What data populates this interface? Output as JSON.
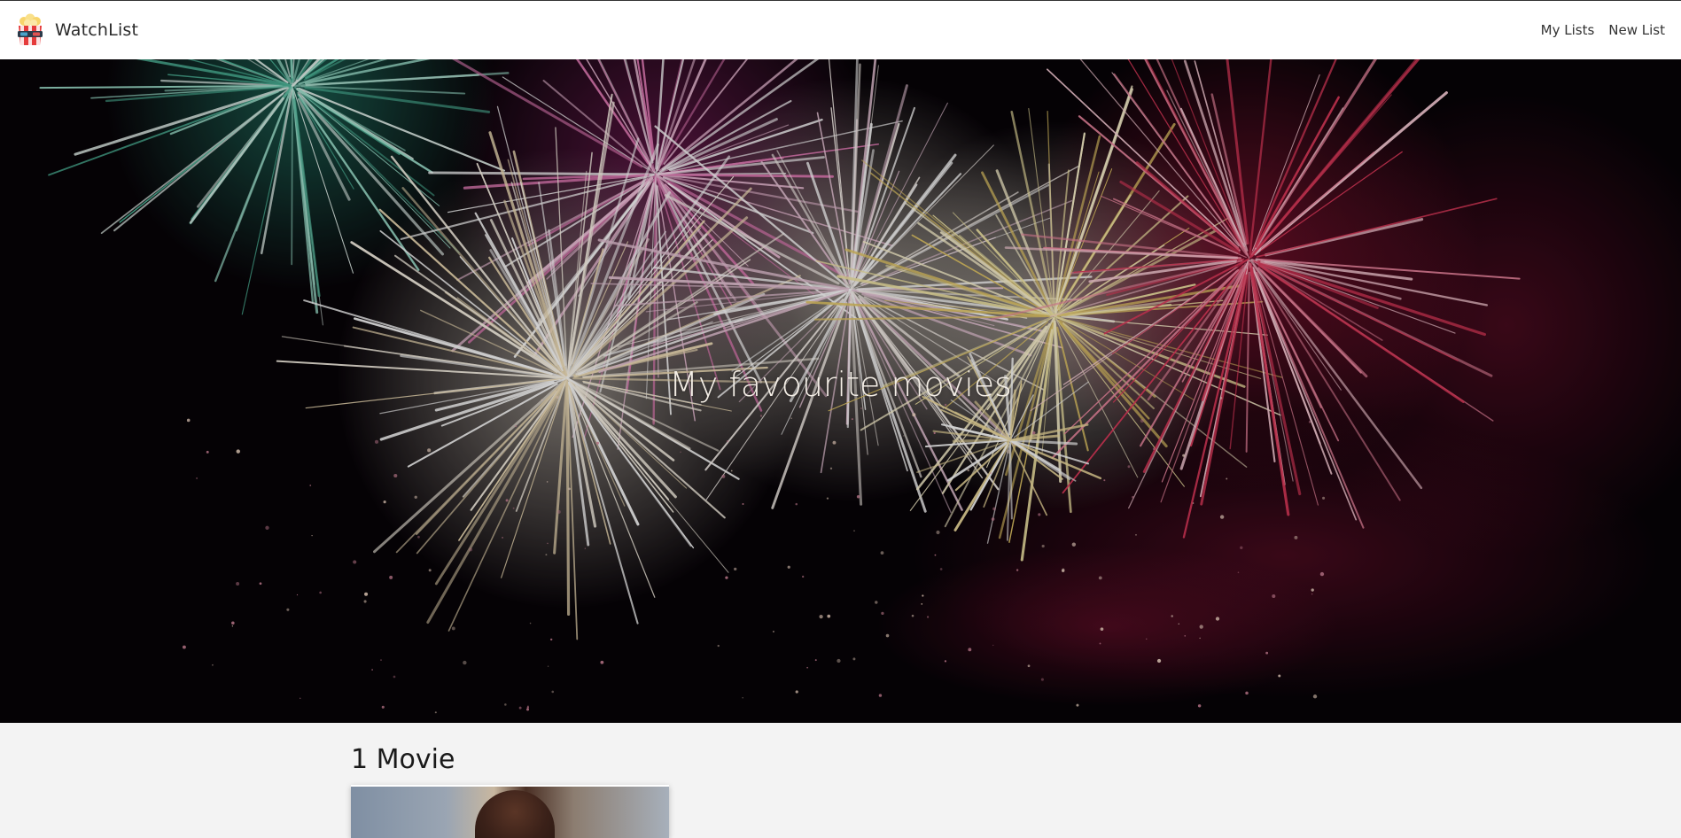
{
  "app": {
    "name": "WatchList",
    "logo_icon": "popcorn-box-icon"
  },
  "nav": {
    "links": [
      {
        "label": "My Lists"
      },
      {
        "label": "New List"
      }
    ]
  },
  "hero": {
    "title": "My favourite movies",
    "background": "fireworks-image"
  },
  "list": {
    "count_label": "1 Movie",
    "movies": [
      {
        "poster": "movie-poster-image"
      }
    ]
  }
}
